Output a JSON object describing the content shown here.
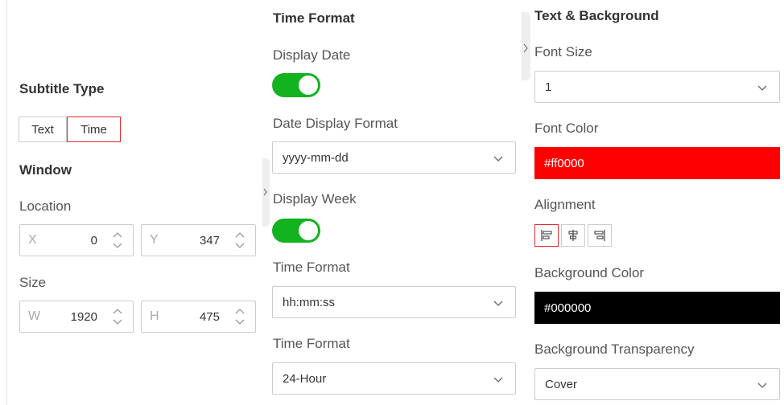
{
  "subtitle_type": {
    "heading": "Subtitle Type",
    "options": [
      "Text",
      "Time"
    ],
    "selected": "Time"
  },
  "window": {
    "heading": "Window",
    "location_label": "Location",
    "x": {
      "prefix": "X",
      "value": "0"
    },
    "y": {
      "prefix": "Y",
      "value": "347"
    },
    "size_label": "Size",
    "w": {
      "prefix": "W",
      "value": "1920"
    },
    "h": {
      "prefix": "H",
      "value": "475"
    }
  },
  "time_format_section": {
    "heading": "Time Format",
    "display_date_label": "Display Date",
    "display_date_on": true,
    "date_display_format_label": "Date Display Format",
    "date_display_format_value": "yyyy-mm-dd",
    "display_week_label": "Display Week",
    "display_week_on": true,
    "time_format_label": "Time Format",
    "time_format_value": "hh:mm:ss",
    "hour_format_label": "Time Format",
    "hour_format_value": "24-Hour"
  },
  "text_background": {
    "heading": "Text & Background",
    "font_size_label": "Font Size",
    "font_size_value": "1",
    "font_color_label": "Font Color",
    "font_color_value": "#ff0000",
    "alignment_label": "Alignment",
    "alignment_options": [
      "align-left-icon",
      "align-center-icon",
      "align-right-icon"
    ],
    "alignment_selected": "align-left-icon",
    "background_color_label": "Background Color",
    "background_color_value": "#000000",
    "background_transparency_label": "Background Transparency",
    "background_transparency_value": "Cover"
  },
  "colors": {
    "accent_red": "#e0282e",
    "toggle_green": "#13b21f"
  }
}
